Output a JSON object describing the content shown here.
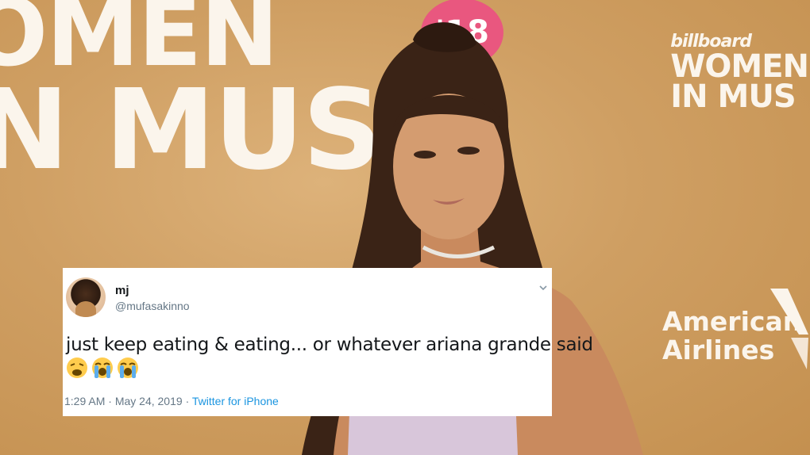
{
  "backdrop": {
    "headline_top": "OMEN",
    "headline_bottom": "N MUSI",
    "badge": "'18",
    "logo_brand": "billboard",
    "logo_line1": "WOMEN",
    "logo_line2": "IN MUS",
    "sponsor_line1": "American",
    "sponsor_line2": "Airlines"
  },
  "tweet": {
    "display_name": "mj",
    "handle": "@mufasakinno",
    "text": "just keep eating & eating... or whatever ariana grande said",
    "emojis": [
      "weary-face",
      "loudly-crying-face",
      "loudly-crying-face"
    ],
    "time": "1:29 AM",
    "separator": "·",
    "date": "May 24, 2019",
    "source": "Twitter for iPhone"
  },
  "colors": {
    "backdrop": "#cf9f63",
    "badge": "#e9577f",
    "link": "#1b95e0",
    "muted": "#657786"
  }
}
